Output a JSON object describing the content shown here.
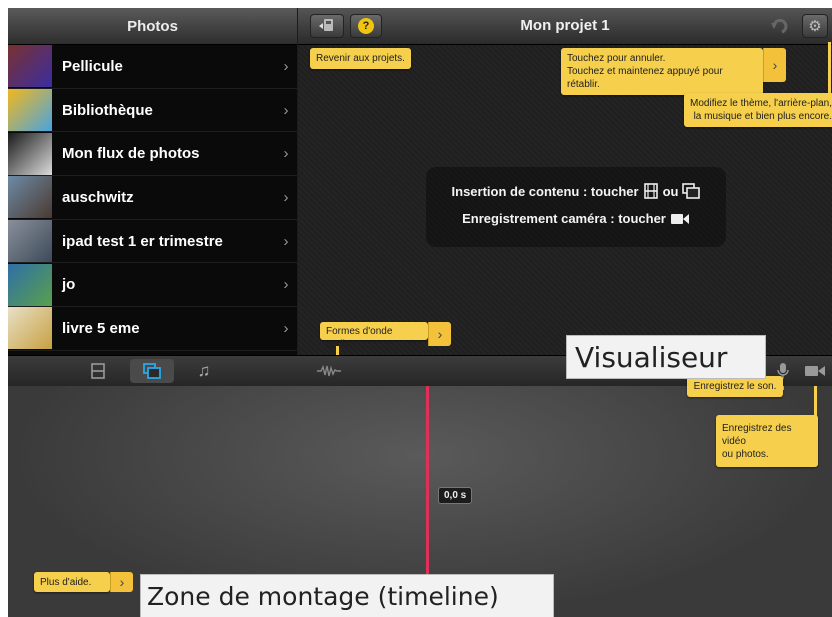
{
  "photos_panel": {
    "title": "Photos",
    "albums": [
      {
        "label": "Pellicule",
        "thumb_color": "#7a3030",
        "thumb_accent": "#3a2ea0"
      },
      {
        "label": "Bibliothèque",
        "thumb_color": "#f2b81c",
        "thumb_accent": "#4aa3e0"
      },
      {
        "label": "Mon flux de photos",
        "thumb_color": "#1a1a1a",
        "thumb_accent": "#dcdcdc"
      },
      {
        "label": "auschwitz",
        "thumb_color": "#6e8aa6",
        "thumb_accent": "#4a3a30"
      },
      {
        "label": "ipad test 1 er trimestre",
        "thumb_color": "#8a8f9a",
        "thumb_accent": "#3c4a5a"
      },
      {
        "label": "jo",
        "thumb_color": "#2e6fa8",
        "thumb_accent": "#5aa04a"
      },
      {
        "label": "livre 5 eme",
        "thumb_color": "#e8e0c8",
        "thumb_accent": "#c8a040"
      }
    ]
  },
  "project": {
    "title": "Mon projet 1",
    "help_label": "?"
  },
  "message": {
    "insert_label": "Insertion de contenu : toucher",
    "insert_or": "ou",
    "record_label": "Enregistrement caméra : toucher"
  },
  "tips": {
    "back_projects": "Revenir aux projets.",
    "undo_line1": "Touchez pour annuler.",
    "undo_line2": "Touchez et maintenez appuyé pour rétablir.",
    "settings_line1": "Modifiez le thème, l'arrière-plan,",
    "settings_line2": "la musique et bien plus encore.",
    "waveform": "Formes d'onde audio.",
    "record_sound": "Enregistrez le son.",
    "record_video_line1": "Enregistrez des vidéo",
    "record_video_line2": "ou photos.",
    "more_help": "Plus d'aide.",
    "chevron": "›"
  },
  "timeline": {
    "time": "0,0 s"
  },
  "annotations": {
    "viewer": "Visualiseur",
    "timeline_zone": "Zone de montage (timeline)"
  },
  "colors": {
    "tip_yellow": "#f6d04d",
    "playhead": "#e0305a",
    "active_tab": "#2aa8e8"
  },
  "icons": {
    "chevron": "›",
    "back": "back-to-projects-icon",
    "undo": "undo-icon",
    "settings": "gear-icon"
  }
}
